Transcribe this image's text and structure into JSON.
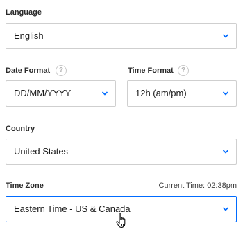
{
  "language": {
    "label": "Language",
    "value": "English"
  },
  "date_format": {
    "label": "Date Format",
    "value": "DD/MM/YYYY"
  },
  "time_format": {
    "label": "Time Format",
    "value": "12h (am/pm)"
  },
  "country": {
    "label": "Country",
    "value": "United States"
  },
  "time_zone": {
    "label": "Time Zone",
    "current_time_label": "Current Time:",
    "current_time_value": "02:38pm",
    "value": "Eastern Time - US & Canada"
  },
  "help_glyph": "?",
  "colors": {
    "accent": "#006bff",
    "border": "#cfcfcf"
  },
  "icons": {
    "chevron": "chevron-down-icon",
    "help": "help-icon",
    "cursor": "hand-pointer-cursor"
  }
}
